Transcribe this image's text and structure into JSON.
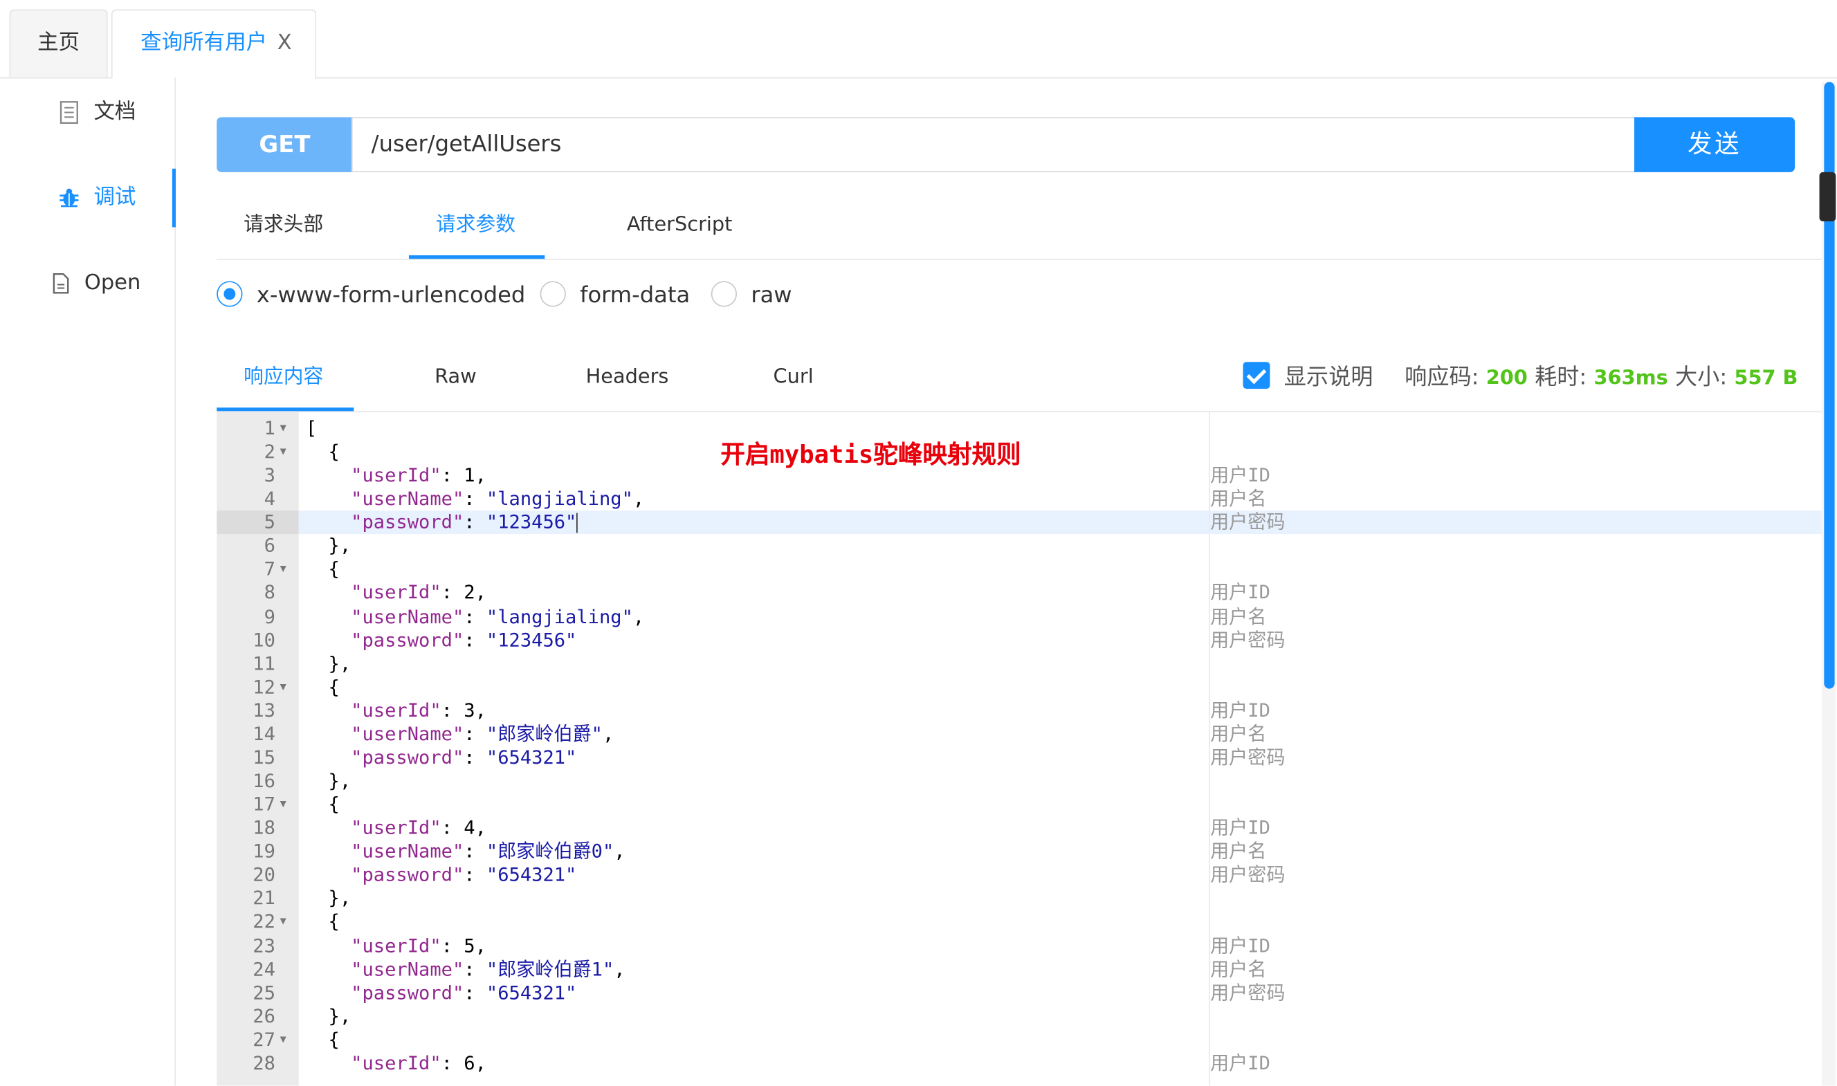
{
  "tabs": {
    "home": "主页",
    "active": "查询所有用户",
    "close_glyph": "X"
  },
  "sidebar": {
    "items": [
      {
        "label": "文档",
        "icon": "document-icon"
      },
      {
        "label": "调试",
        "icon": "bug-icon"
      },
      {
        "label": "Open",
        "icon": "file-icon"
      }
    ]
  },
  "request": {
    "method": "GET",
    "url": "/user/getAllUsers",
    "send_label": "发送",
    "tabs": [
      "请求头部",
      "请求参数",
      "AfterScript"
    ],
    "body_types": [
      "x-www-form-urlencoded",
      "form-data",
      "raw"
    ],
    "selected_body_type": "x-www-form-urlencoded"
  },
  "response": {
    "tabs": [
      "响应内容",
      "Raw",
      "Headers",
      "Curl"
    ],
    "show_desc_label": "显示说明",
    "status_label": "响应码:",
    "status_value": "200",
    "time_label": "耗时:",
    "time_value": "363ms",
    "size_label": "大小:",
    "size_value": "557 B",
    "annotation": "开启mybatis驼峰映射规则",
    "lines": [
      {
        "n": "1",
        "fold": true,
        "code": "[",
        "desc": ""
      },
      {
        "n": "2",
        "fold": true,
        "code": "  {",
        "desc": ""
      },
      {
        "n": "3",
        "key": "\"userId\"",
        "sep": ": ",
        "val": "1",
        "type": "num",
        "tail": ",",
        "desc": "用户ID"
      },
      {
        "n": "4",
        "key": "\"userName\"",
        "sep": ": ",
        "val": "\"langjialing\"",
        "type": "str",
        "tail": ",",
        "desc": "用户名"
      },
      {
        "n": "5",
        "key": "\"password\"",
        "sep": ": ",
        "val": "\"123456\"",
        "type": "str",
        "tail": "",
        "desc": "用户密码"
      },
      {
        "n": "6",
        "code": "  },",
        "desc": ""
      },
      {
        "n": "7",
        "fold": true,
        "code": "  {",
        "desc": ""
      },
      {
        "n": "8",
        "key": "\"userId\"",
        "sep": ": ",
        "val": "2",
        "type": "num",
        "tail": ",",
        "desc": "用户ID"
      },
      {
        "n": "9",
        "key": "\"userName\"",
        "sep": ": ",
        "val": "\"langjialing\"",
        "type": "str",
        "tail": ",",
        "desc": "用户名"
      },
      {
        "n": "10",
        "key": "\"password\"",
        "sep": ": ",
        "val": "\"123456\"",
        "type": "str",
        "tail": "",
        "desc": "用户密码"
      },
      {
        "n": "11",
        "code": "  },",
        "desc": ""
      },
      {
        "n": "12",
        "fold": true,
        "code": "  {",
        "desc": ""
      },
      {
        "n": "13",
        "key": "\"userId\"",
        "sep": ": ",
        "val": "3",
        "type": "num",
        "tail": ",",
        "desc": "用户ID"
      },
      {
        "n": "14",
        "key": "\"userName\"",
        "sep": ": ",
        "val": "\"郎家岭伯爵\"",
        "type": "str",
        "tail": ",",
        "desc": "用户名"
      },
      {
        "n": "15",
        "key": "\"password\"",
        "sep": ": ",
        "val": "\"654321\"",
        "type": "str",
        "tail": "",
        "desc": "用户密码"
      },
      {
        "n": "16",
        "code": "  },",
        "desc": ""
      },
      {
        "n": "17",
        "fold": true,
        "code": "  {",
        "desc": ""
      },
      {
        "n": "18",
        "key": "\"userId\"",
        "sep": ": ",
        "val": "4",
        "type": "num",
        "tail": ",",
        "desc": "用户ID"
      },
      {
        "n": "19",
        "key": "\"userName\"",
        "sep": ": ",
        "val": "\"郎家岭伯爵0\"",
        "type": "str",
        "tail": ",",
        "desc": "用户名"
      },
      {
        "n": "20",
        "key": "\"password\"",
        "sep": ": ",
        "val": "\"654321\"",
        "type": "str",
        "tail": "",
        "desc": "用户密码"
      },
      {
        "n": "21",
        "code": "  },",
        "desc": ""
      },
      {
        "n": "22",
        "fold": true,
        "code": "  {",
        "desc": ""
      },
      {
        "n": "23",
        "key": "\"userId\"",
        "sep": ": ",
        "val": "5",
        "type": "num",
        "tail": ",",
        "desc": "用户ID"
      },
      {
        "n": "24",
        "key": "\"userName\"",
        "sep": ": ",
        "val": "\"郎家岭伯爵1\"",
        "type": "str",
        "tail": ",",
        "desc": "用户名"
      },
      {
        "n": "25",
        "key": "\"password\"",
        "sep": ": ",
        "val": "\"654321\"",
        "type": "str",
        "tail": "",
        "desc": "用户密码"
      },
      {
        "n": "26",
        "code": "  },",
        "desc": ""
      },
      {
        "n": "27",
        "fold": true,
        "code": "  {",
        "desc": ""
      },
      {
        "n": "28",
        "key": "\"userId\"",
        "sep": ": ",
        "val": "6",
        "type": "num",
        "tail": ",",
        "desc": "用户ID"
      }
    ]
  }
}
